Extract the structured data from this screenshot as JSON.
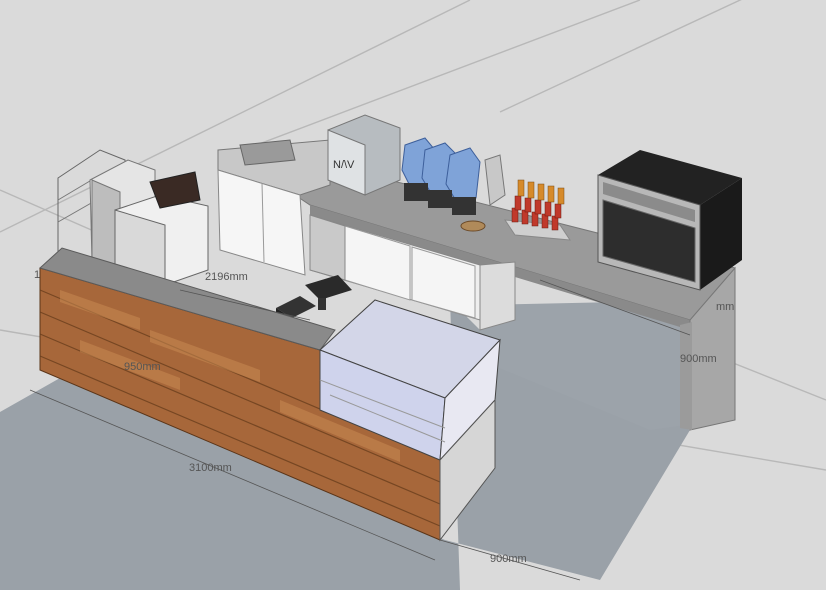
{
  "diagram": {
    "dimensions": {
      "counter_length": "3100mm",
      "front_depth": "900mm",
      "back_depth": "900mm",
      "inner_run": "2196mm",
      "front_height": "950mm",
      "left_height": "1",
      "right_top_partial": "mm"
    },
    "objects": [
      "wood-clad-front-counter",
      "curved-glass-display-fridge",
      "pos-terminal",
      "cash-drawer",
      "back-counter-grey-stone",
      "under-counter-fridge",
      "wall-oven",
      "syrup-bottle-rack",
      "coffee-grinder-trio",
      "countertop-box-unit",
      "sink-cabinet",
      "ice-machine",
      "cup-dispenser-rack",
      "espresso-machine"
    ],
    "box_unit_label": "N/\\V"
  }
}
